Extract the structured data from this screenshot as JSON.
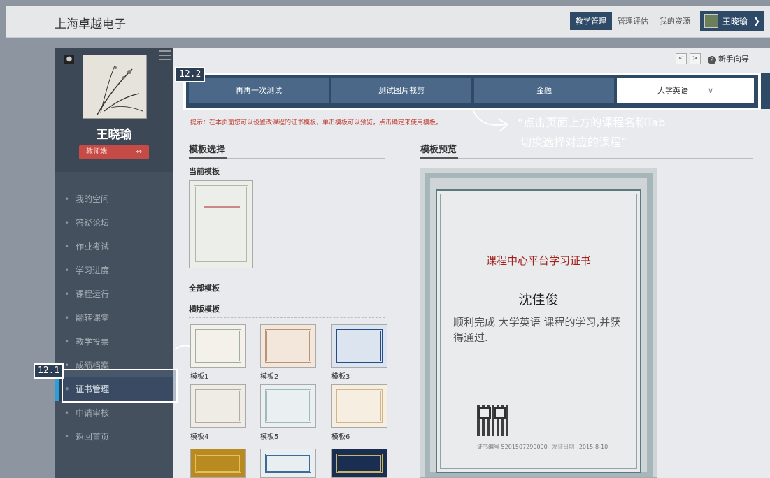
{
  "header": {
    "brand": "上海卓越电子",
    "nav": [
      "教学管理",
      "管理评估",
      "我的资源"
    ],
    "user_name": "王晓瑜"
  },
  "sidebar": {
    "name": "王晓瑜",
    "badge": "教师端",
    "items": [
      {
        "label": "我的空间"
      },
      {
        "label": "答疑论坛"
      },
      {
        "label": "作业考试"
      },
      {
        "label": "学习进度"
      },
      {
        "label": "课程运行"
      },
      {
        "label": "翻转课堂"
      },
      {
        "label": "教学投票"
      },
      {
        "label": "成绩档案"
      },
      {
        "label": "证书管理",
        "active": true
      },
      {
        "label": "申请审核"
      },
      {
        "label": "返回首页"
      }
    ]
  },
  "annotations": {
    "step_menu": "12.1",
    "step_tabs": "12.2",
    "callout_line1": "“点击页面上方的课程名称Tab",
    "callout_line2": "切换选择对应的课程”"
  },
  "toolbar": {
    "prev": "<",
    "next": ">",
    "guide": "新手向导"
  },
  "tabs": [
    {
      "label": "再再一次测试"
    },
    {
      "label": "测试图片裁剪"
    },
    {
      "label": "金融"
    },
    {
      "label": "大学英语",
      "selected": true
    }
  ],
  "hint": "提示：在本页面您可以设置改课程的证书模板，单击模板可以预览，点击确定来使用模板。",
  "template_select": {
    "title": "模板选择",
    "current_label": "当前模板",
    "all_label": "全部模板",
    "landscape_label": "横版模板",
    "templates": [
      "模板1",
      "模板2",
      "模板3",
      "模板4",
      "模板5",
      "模板6"
    ]
  },
  "preview": {
    "title": "模板预览",
    "cert_title": "课程中心平台学习证书",
    "cert_name": "沈佳俊",
    "cert_body": "顺利完成 大学英语 课程的学习,并获得通过.",
    "cert_no_label": "证书编号",
    "cert_no": "5201507290000",
    "issue_label": "发证日期",
    "issue_date": "2015-8-10"
  }
}
